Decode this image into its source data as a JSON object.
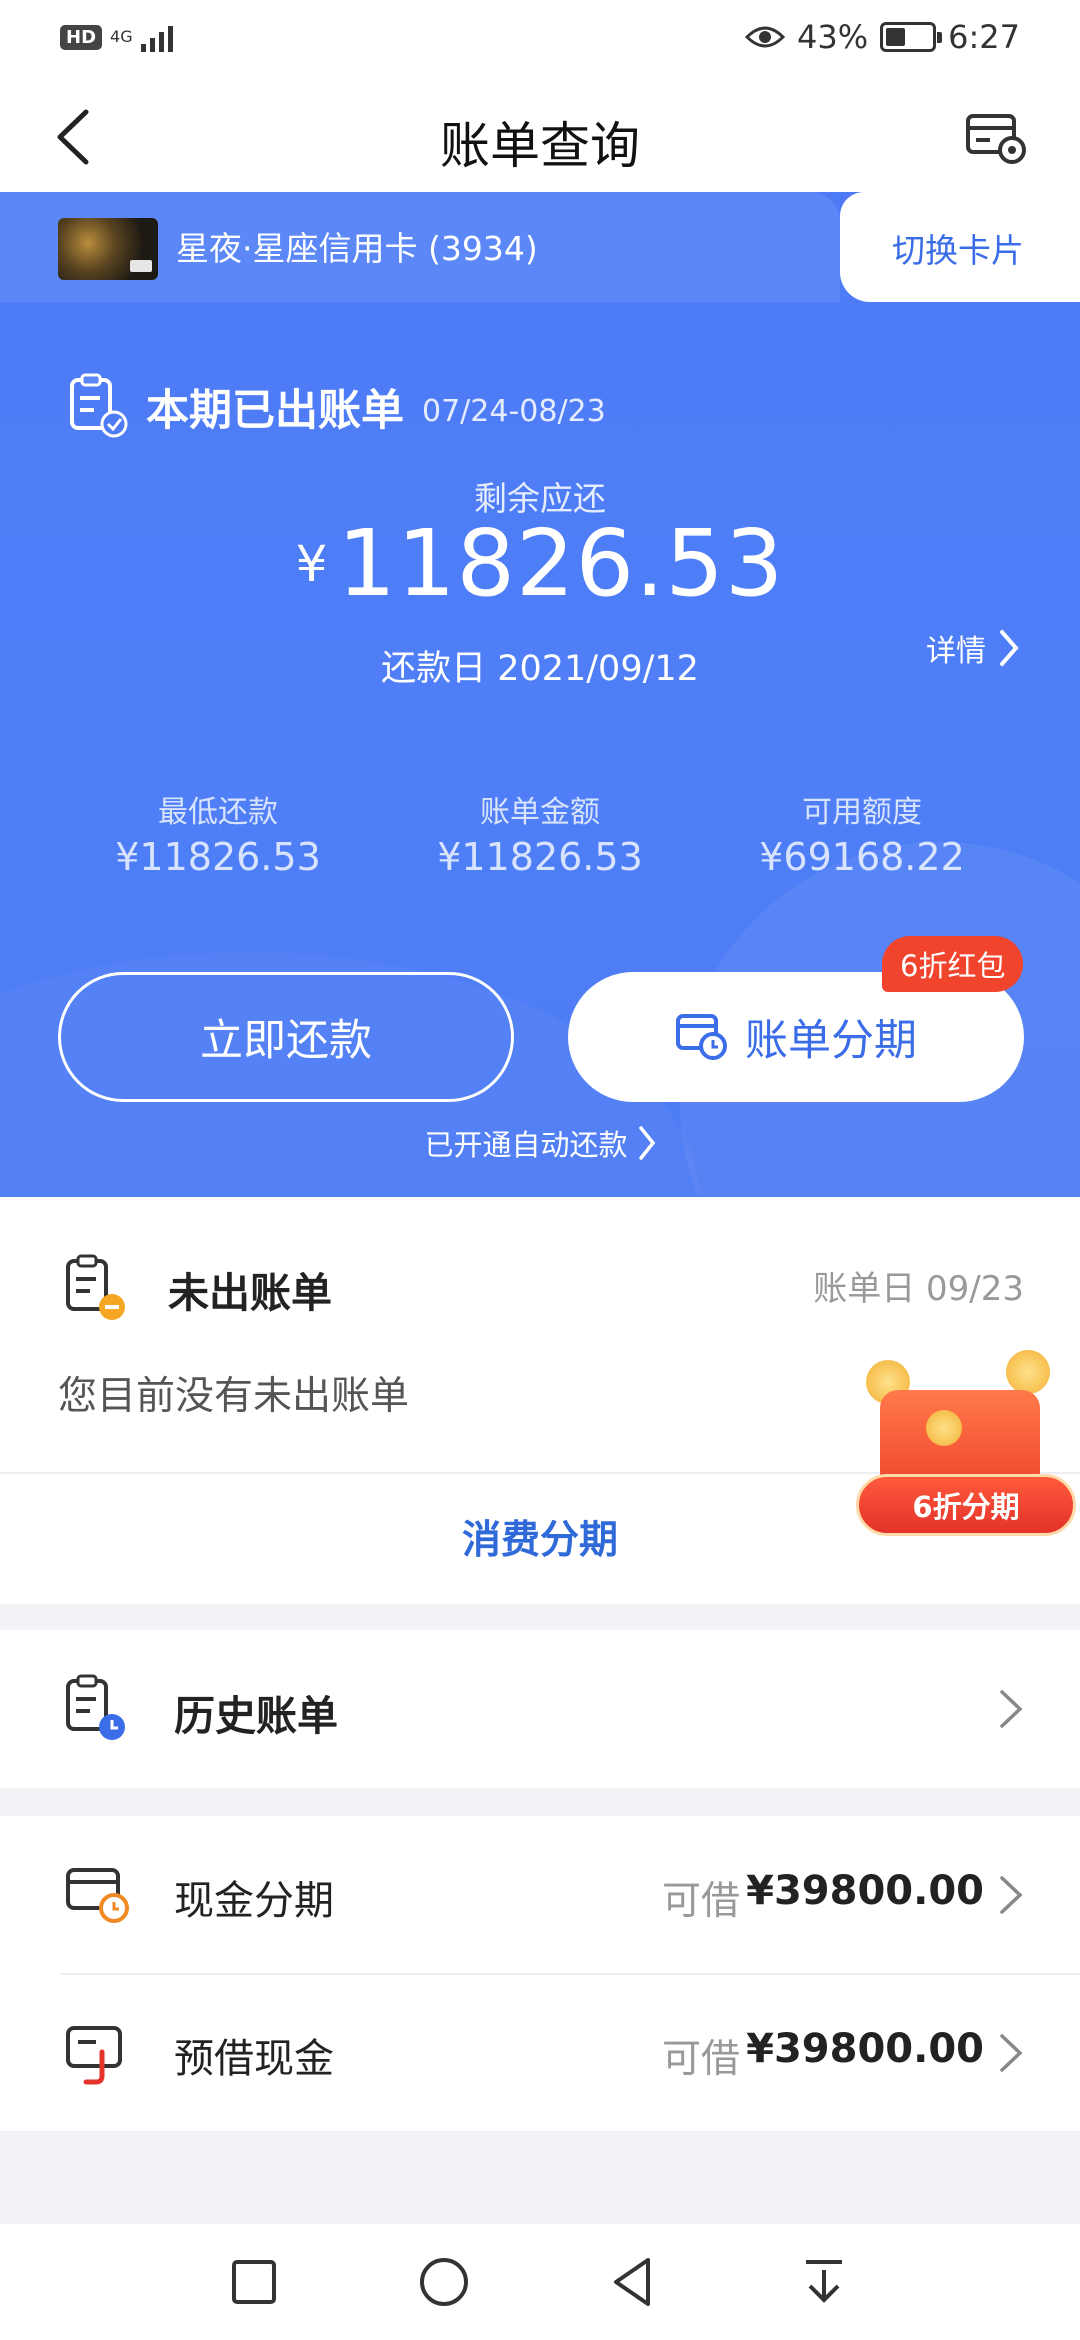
{
  "status_bar": {
    "hd": "HD",
    "network": "4G",
    "battery_percent": "43%",
    "battery_level": 0.43,
    "time": "6:27"
  },
  "header": {
    "title": "账单查询",
    "back_icon": "chevron-left-icon",
    "settings_icon": "card-settings-icon"
  },
  "card": {
    "name": "星夜·星座信用卡 (3934)",
    "switch_label": "切换卡片"
  },
  "current_bill": {
    "title": "本期已出账单",
    "period": "07/24-08/23",
    "remaining_label": "剩余应还",
    "currency": "¥",
    "remaining_amount": "11826.53",
    "due_date": "还款日 2021/09/12",
    "detail_label": "详情",
    "stats": [
      {
        "label": "最低还款",
        "value": "¥11826.53"
      },
      {
        "label": "账单金额",
        "value": "¥11826.53"
      },
      {
        "label": "可用额度",
        "value": "¥69168.22"
      }
    ],
    "repay_button": "立即还款",
    "installment_button": "账单分期",
    "promo_badge": "6折红包",
    "autopay_label": "已开通自动还款"
  },
  "unbilled": {
    "title": "未出账单",
    "bill_day": "账单日 09/23",
    "empty_text": "您目前没有未出账单",
    "consume_installment": "消费分期",
    "red_packet_label": "6折分期"
  },
  "history": {
    "title": "历史账单"
  },
  "cash": [
    {
      "name": "现金分期",
      "borrow_label": "可借",
      "amount": "¥39800.00"
    },
    {
      "name": "预借现金",
      "borrow_label": "可借",
      "amount": "¥39800.00"
    }
  ],
  "colors": {
    "primary_blue": "#4d7bf6",
    "link_blue": "#2f6ad8",
    "promo_red": "#f0442d",
    "accent_orange": "#f5a623"
  }
}
